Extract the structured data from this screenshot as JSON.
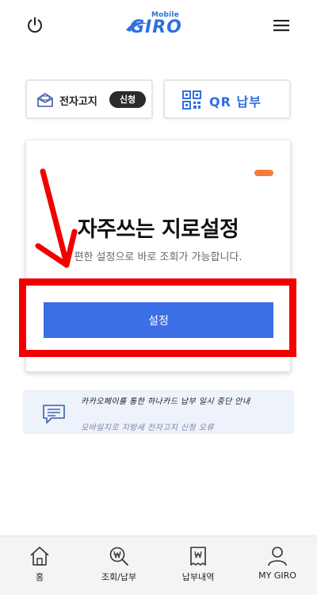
{
  "header": {
    "logo_sub": "Mobile",
    "logo_main": "GIRO",
    "icons": {
      "left": "power-icon",
      "right": "hamburger-menu-icon"
    }
  },
  "quick_actions": {
    "notice": {
      "label": "전자고지",
      "badge": "신청",
      "icon": "mail-icon"
    },
    "qr": {
      "label": "QR 납부",
      "icon": "qr-code-icon"
    }
  },
  "card": {
    "title": "자주쓰는 지로설정",
    "description": "편한 설정으로 바로 조회가 가능합니다.",
    "button_label": "설정",
    "badge_color": "#f47c3c",
    "button_color": "#3c6ee5"
  },
  "banner": {
    "title": "카카오페이를 통한 하나카드 납부 일시 중단 안내",
    "subtitle": "모바일지로 지방세 전자고지 신청 오류",
    "icon": "chat-icon"
  },
  "tabbar": {
    "tabs": [
      {
        "label": "홈",
        "icon": "home-icon"
      },
      {
        "label": "조회/납부",
        "icon": "won-search-icon"
      },
      {
        "label": "납부내역",
        "icon": "receipt-icon"
      },
      {
        "label": "MY GIRO",
        "icon": "user-icon"
      }
    ]
  },
  "annotation": {
    "highlight_color": "#f20000"
  }
}
